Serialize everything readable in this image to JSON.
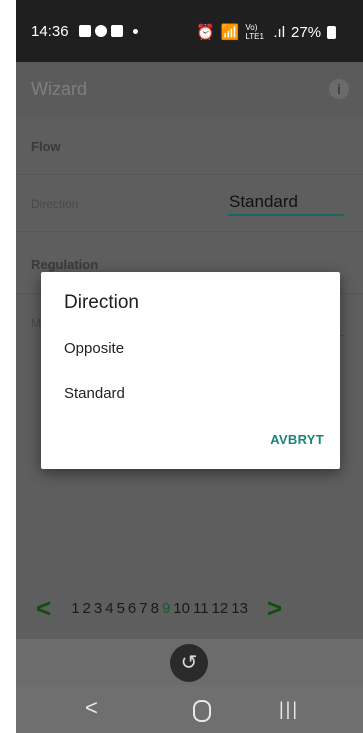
{
  "status_bar": {
    "time": "14:36",
    "network": "Vo) LTE1",
    "battery": "27%"
  },
  "appbar": {
    "title": "Wizard",
    "info_icon": "i"
  },
  "form": {
    "flow_section": "Flow",
    "direction_label": "Direction",
    "direction_value": "Standard",
    "regulation_section": "Regulation",
    "mode_label_partial": "M"
  },
  "pager": {
    "prev": "<",
    "next": ">",
    "pages": [
      "1",
      "2",
      "3",
      "4",
      "5",
      "6",
      "7",
      "8",
      "9",
      "10",
      "11",
      "12",
      "13"
    ],
    "current": "9"
  },
  "dialog": {
    "title": "Direction",
    "options": [
      "Opposite",
      "Standard"
    ],
    "cancel_label": "AVBRYT"
  },
  "bottom": {
    "back_glyph": "↺"
  },
  "navbar": {
    "back": "<",
    "recent": "|||"
  },
  "colors": {
    "accent": "#178676",
    "pager_active": "#0d5f2f",
    "arrow": "#0e4f0e"
  }
}
